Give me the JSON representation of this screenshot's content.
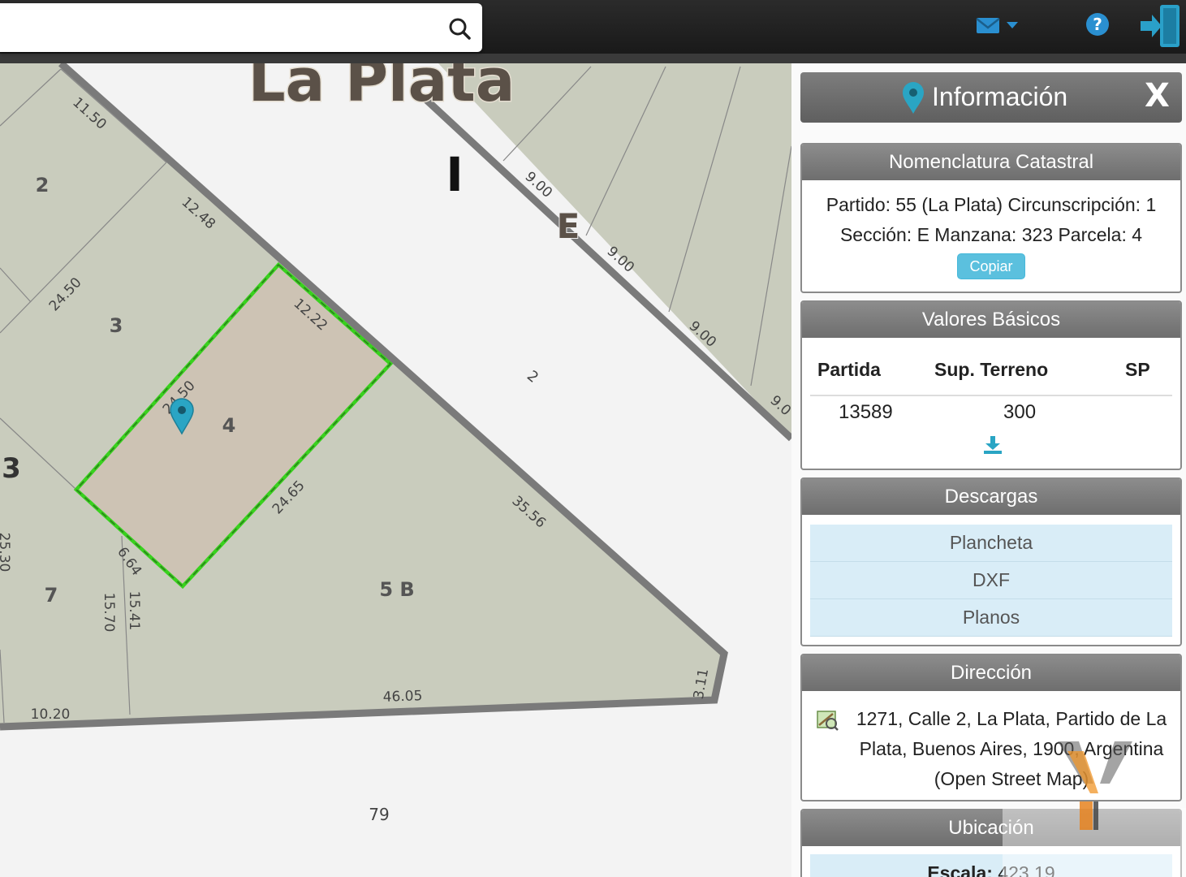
{
  "search": {
    "placeholder": ""
  },
  "map": {
    "city_label": "La Plata",
    "circ_label": "I",
    "section_label": "E",
    "street_number": "2",
    "block_label": "79",
    "parcels": [
      "2",
      "3",
      "4",
      "3",
      "7",
      "5 B"
    ],
    "measures": [
      "11.50",
      "12.48",
      "24.50",
      "12.22",
      "24.50",
      "24.65",
      "35.56",
      "6.64",
      "15.70",
      "15.41",
      "25.30",
      "10.20",
      "46.05",
      "3.11",
      "9.00",
      "9.00",
      "9.00",
      "9.0"
    ]
  },
  "panel": {
    "title": "Información",
    "close": "X",
    "nomenclatura": {
      "header": "Nomenclatura Catastral",
      "text": "Partido: 55 (La Plata) Circunscripción: 1 Sección: E Manzana: 323 Parcela: 4",
      "copy_button": "Copiar"
    },
    "valores": {
      "header": "Valores Básicos",
      "columns": [
        "Partida",
        "Sup. Terreno",
        "SP"
      ],
      "row": [
        "13589",
        "300",
        ""
      ]
    },
    "descargas": {
      "header": "Descargas",
      "items": [
        "Plancheta",
        "DXF",
        "Planos"
      ]
    },
    "direccion": {
      "header": "Dirección",
      "text": "1271, Calle 2, La Plata, Partido de La Plata, Buenos Aires, 1900, Argentina (Open Street Map)"
    },
    "ubicacion": {
      "header": "Ubicación",
      "scale_label": "Escala:",
      "scale_value": "423.19"
    }
  },
  "colors": {
    "parcel_fill": "#c9ccbd",
    "selected_fill": "#cdc3b4",
    "selected_border": "#39d11e",
    "marker": "#2aa5c4",
    "header_gray": "#757575",
    "accent": "#5bc0de"
  }
}
